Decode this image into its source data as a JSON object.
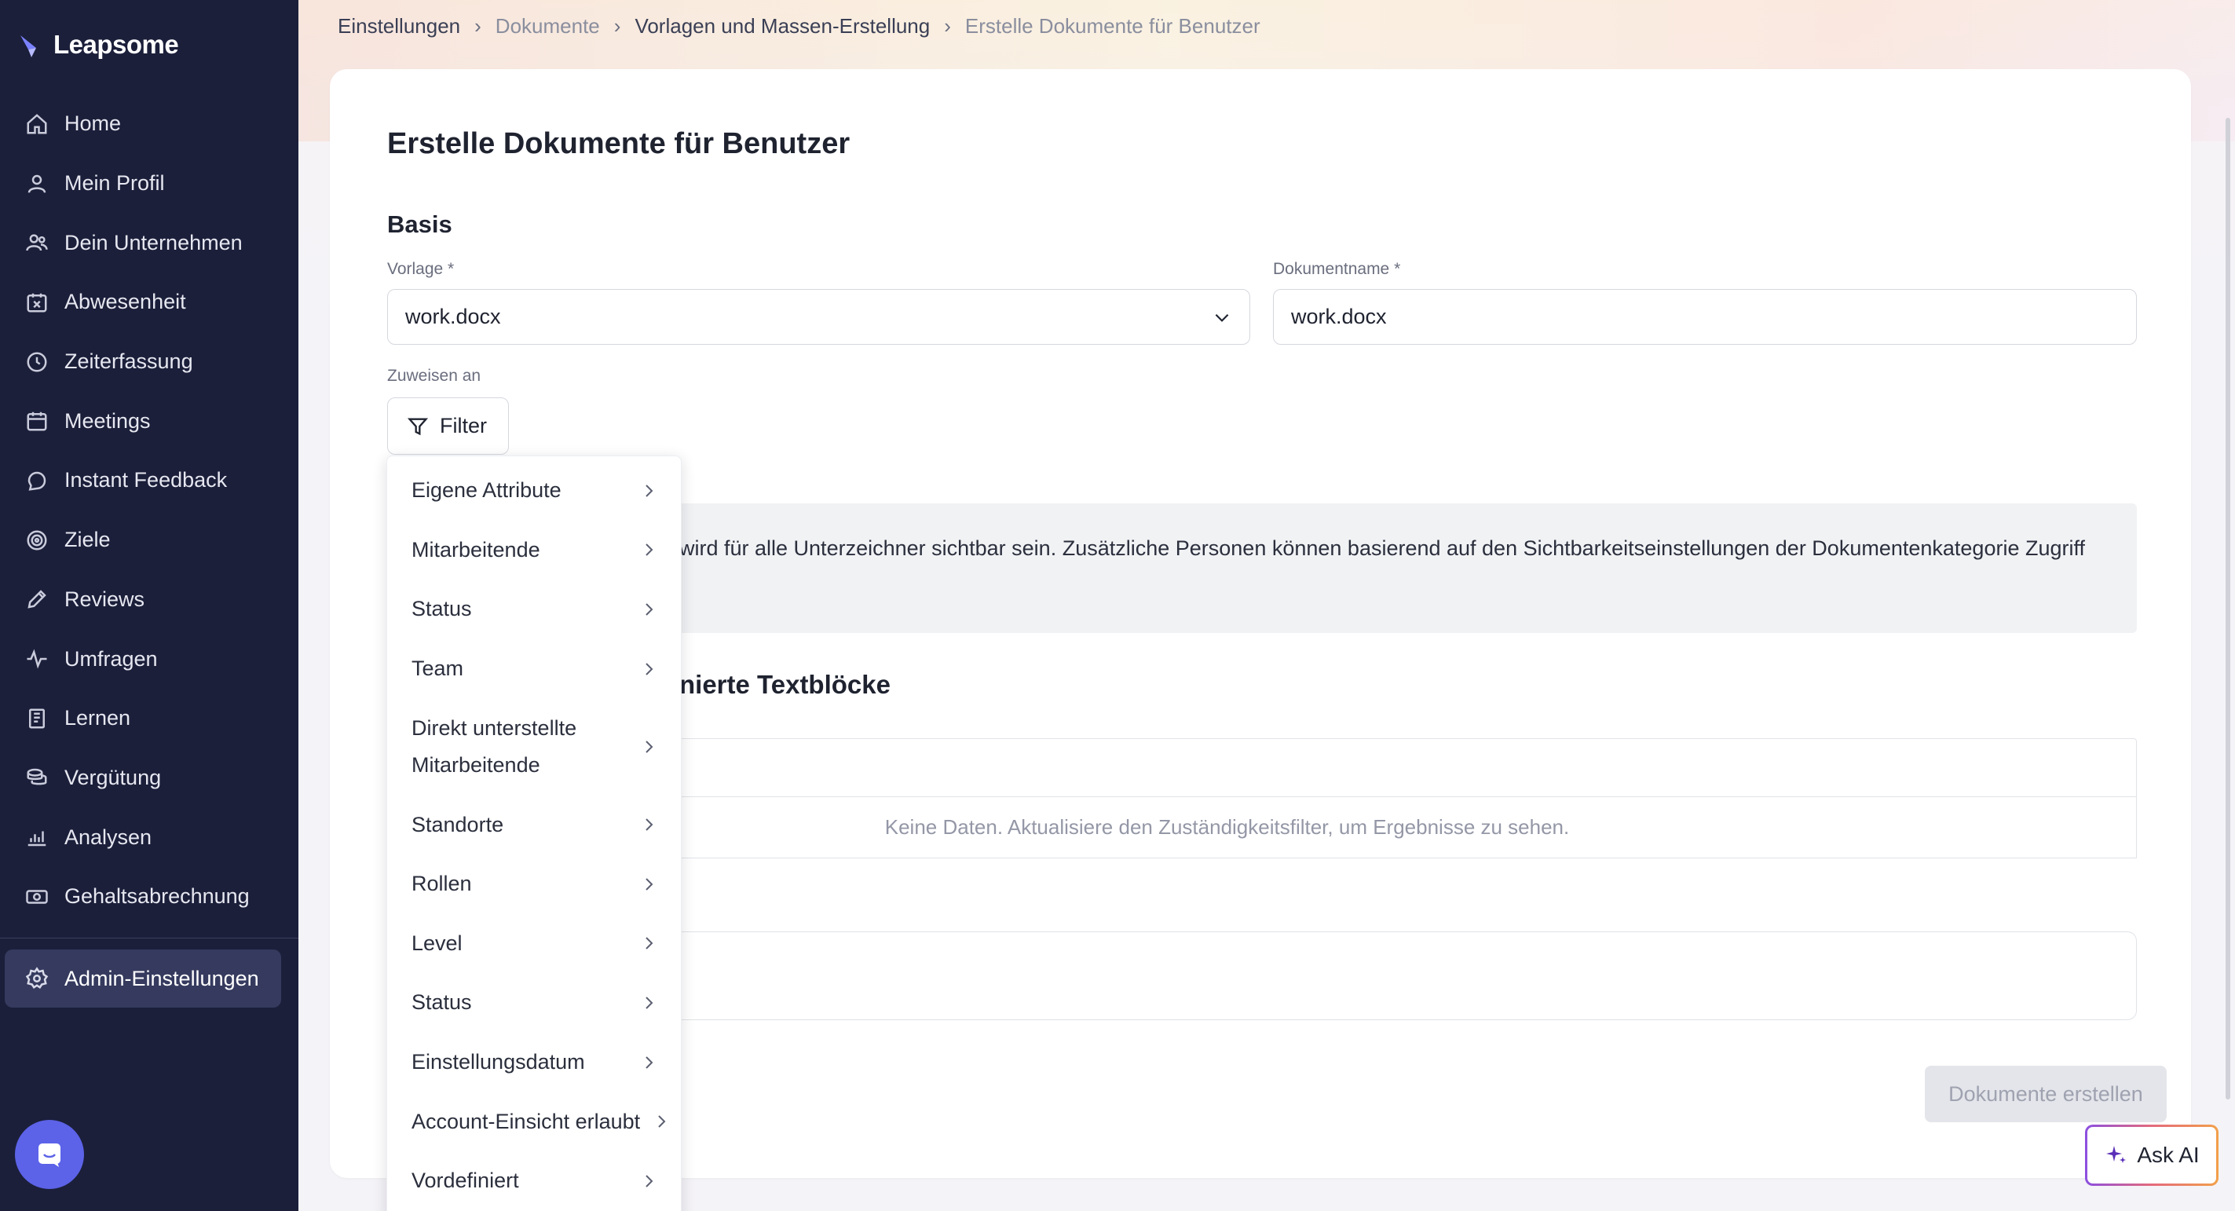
{
  "app": {
    "logo_text": "Leapsome"
  },
  "sidebar": {
    "items": [
      {
        "label": "Home",
        "icon": "home-icon"
      },
      {
        "label": "Mein Profil",
        "icon": "user-icon"
      },
      {
        "label": "Dein Unternehmen",
        "icon": "users-icon"
      },
      {
        "label": "Abwesenheit",
        "icon": "calendar-x-icon"
      },
      {
        "label": "Zeiterfassung",
        "icon": "clock-icon"
      },
      {
        "label": "Meetings",
        "icon": "calendar-icon"
      },
      {
        "label": "Instant Feedback",
        "icon": "chat-icon"
      },
      {
        "label": "Ziele",
        "icon": "target-icon"
      },
      {
        "label": "Reviews",
        "icon": "pen-icon"
      },
      {
        "label": "Umfragen",
        "icon": "pulse-icon"
      },
      {
        "label": "Lernen",
        "icon": "book-icon"
      },
      {
        "label": "Vergütung",
        "icon": "coins-icon"
      },
      {
        "label": "Analysen",
        "icon": "chart-icon"
      },
      {
        "label": "Gehaltsabrechnung",
        "icon": "money-icon"
      }
    ],
    "admin": {
      "label": "Admin-Einstellungen",
      "icon": "gear-icon"
    }
  },
  "breadcrumb": {
    "items": [
      "Einstellungen",
      "Dokumente",
      "Vorlagen und Massen-Erstellung",
      "Erstelle Dokumente für Benutzer"
    ]
  },
  "page": {
    "title": "Erstelle Dokumente für Benutzer",
    "section_basis": "Basis",
    "template_label": "Vorlage *",
    "template_value": "work.docx",
    "docname_label": "Dokumentname *",
    "docname_value": "work.docx",
    "assign_label": "Zuweisen an",
    "filter_label": "Filter",
    "info_text": "wird für alle Unterzeichner sichtbar sein. Zusätzliche Personen können basierend auf den Sichtbarkeitseinstellungen der Dokumentenkategorie Zugriff",
    "section2_title": "nierte Textblöcke",
    "empty_text": "Keine Daten. Aktualisiere den Zuständigkeitsfilter, um Ergebnisse zu sehen.",
    "create_button": "Dokumente erstellen"
  },
  "filter_menu": {
    "items": [
      "Eigene Attribute",
      "Mitarbeitende",
      "Status",
      "Team",
      "Direkt unterstellte Mitarbeitende",
      "Standorte",
      "Rollen",
      "Level",
      "Status",
      "Einstellungsdatum",
      "Account-Einsicht erlaubt",
      "Vordefiniert"
    ]
  },
  "ask_ai": {
    "label": "Ask AI"
  },
  "colors": {
    "sidebar_bg": "#1b1f3a",
    "admin_active_bg": "#353a5e",
    "chat_bubble": "#5c63e8",
    "button_disabled_bg": "#e4e5ea"
  }
}
